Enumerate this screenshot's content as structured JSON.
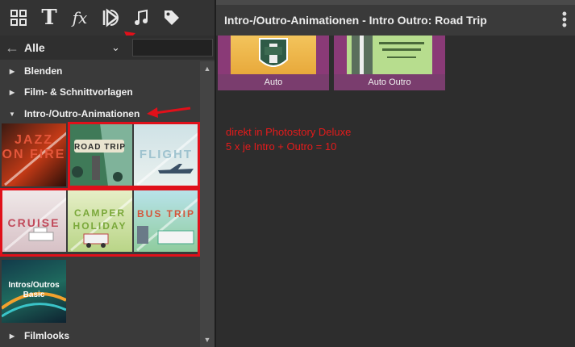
{
  "toolbar": {
    "icons": [
      "grid-icon",
      "text-icon",
      "fx-icon",
      "intro-outro-icon",
      "music-icon",
      "tag-icon"
    ],
    "text_label": "T",
    "fx_label": "fx"
  },
  "filter": {
    "selected": "Alle"
  },
  "tree": {
    "items": [
      {
        "label": "Blenden"
      },
      {
        "label": "Film- & Schnittvorlagen"
      },
      {
        "label": "Intro-/Outro-Animationen"
      },
      {
        "label": "Filmlooks"
      }
    ]
  },
  "thumbs": {
    "jazz": "JAZZ ON FIRE",
    "road": "ROAD TRIP",
    "flight": "FLIGHT",
    "cruise": "CRUISE",
    "camper": "CAMPER HOLIDAY",
    "bus": "BUS TRIP",
    "basic": "Intros/Outros Basic"
  },
  "right": {
    "title": "Intro-/Outro-Animationen - Intro Outro: Road Trip",
    "items": [
      {
        "label": "Auto"
      },
      {
        "label": "Auto Outro"
      }
    ]
  },
  "annotation": {
    "line1": "direkt in Photostory Deluxe",
    "line2": "5 x je Intro + Outro = 10"
  },
  "colors": {
    "accent_red": "#e0101a",
    "thumb_purple": "#8a3a77"
  }
}
